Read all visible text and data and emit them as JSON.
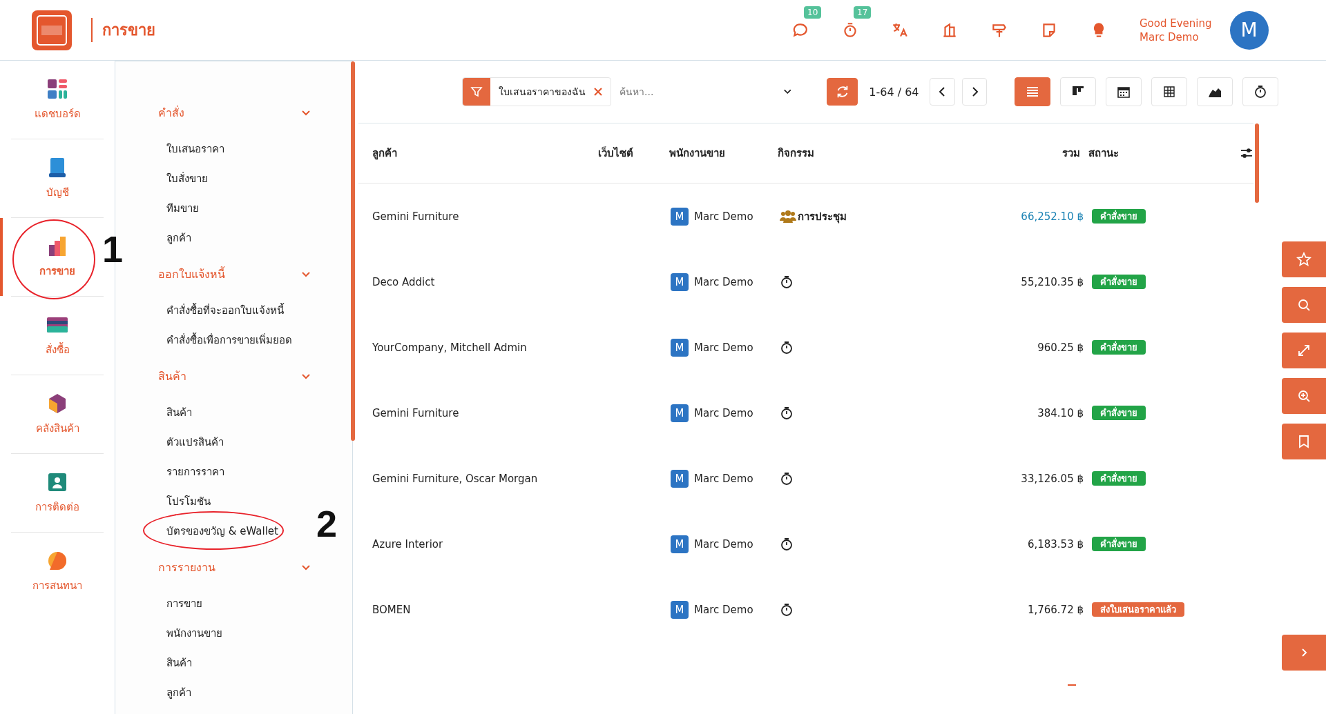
{
  "header": {
    "app_title": "การขาย",
    "badges": [
      {
        "kind": "chat",
        "count": "10"
      },
      {
        "kind": "timer",
        "count": "17"
      },
      {
        "kind": "translate"
      },
      {
        "kind": "building"
      },
      {
        "kind": "signpost"
      },
      {
        "kind": "note"
      },
      {
        "kind": "bulb"
      }
    ],
    "greeting": "Good Evening",
    "user_name": "Marc Demo",
    "avatar_letter": "M"
  },
  "rail": [
    {
      "kind": "dashboard",
      "label": "แดชบอร์ด",
      "selected": false
    },
    {
      "kind": "accounting",
      "label": "บัญชี",
      "selected": false
    },
    {
      "kind": "sales",
      "label": "การขาย",
      "selected": true
    },
    {
      "kind": "purchase",
      "label": "สั่งซื้อ",
      "selected": false
    },
    {
      "kind": "inventory",
      "label": "คลังสินค้า",
      "selected": false
    },
    {
      "kind": "contacts",
      "label": "การติดต่อ",
      "selected": false
    },
    {
      "kind": "discuss",
      "label": "การสนทนา",
      "selected": false
    }
  ],
  "menu": [
    {
      "label": "คำสั่ง",
      "expanded": true,
      "children": [
        {
          "label": "ใบเสนอราคา"
        },
        {
          "label": "ใบสั่งขาย"
        },
        {
          "label": "ทีมขาย"
        },
        {
          "label": "ลูกค้า"
        }
      ]
    },
    {
      "label": "ออกใบแจ้งหนี้",
      "expanded": true,
      "children": [
        {
          "label": "คำสั่งซื้อที่จะออกใบแจ้งหนี้"
        },
        {
          "label": "คำสั่งซื้อเพื่อการขายเพิ่มยอด"
        }
      ]
    },
    {
      "label": "สินค้า",
      "expanded": true,
      "children": [
        {
          "label": "สินค้า"
        },
        {
          "label": "ตัวแปรสินค้า"
        },
        {
          "label": "รายการราคา"
        },
        {
          "label": "โปรโมชัน"
        },
        {
          "label": "บัตรของขวัญ & eWallet"
        }
      ]
    },
    {
      "label": "การรายงาน",
      "expanded": true,
      "children": [
        {
          "label": "การขาย"
        },
        {
          "label": "พนักงานขาย"
        },
        {
          "label": "สินค้า"
        },
        {
          "label": "ลูกค้า"
        }
      ]
    }
  ],
  "annotations": [
    "1",
    "2"
  ],
  "toolbar": {
    "filter": "ใบเสนอราคาของฉัน",
    "search": {
      "placeholder": "ค้นหา..."
    },
    "pager": "1-64 / 64",
    "views": [
      {
        "kind": "list",
        "selected": true
      },
      {
        "kind": "kanban",
        "selected": false
      },
      {
        "kind": "calendar",
        "selected": false
      },
      {
        "kind": "pivot",
        "selected": false
      },
      {
        "kind": "graph",
        "selected": false
      },
      {
        "kind": "activity",
        "selected": false
      }
    ]
  },
  "table": {
    "columns": [
      "ลูกค้า",
      "เว็บไซต์",
      "พนักงานขาย",
      "กิจกรรม",
      "รวม",
      "สถานะ"
    ],
    "rows": [
      {
        "customer": "Gemini Furniture",
        "salesperson": "Marc Demo",
        "avatar_letter": "M",
        "activity": {
          "kind": "meeting",
          "label": "การประชุม"
        },
        "total": "66,252.10 ฿",
        "highlighted": true,
        "status": {
          "kind": "order",
          "label": "คำสั่งขาย"
        }
      },
      {
        "customer": "Deco Addict",
        "salesperson": "Marc Demo",
        "avatar_letter": "M",
        "activity": {
          "kind": "timer"
        },
        "total": "55,210.35 ฿",
        "highlighted": false,
        "status": {
          "kind": "order",
          "label": "คำสั่งขาย"
        }
      },
      {
        "customer": "YourCompany, Mitchell Admin",
        "salesperson": "Marc Demo",
        "avatar_letter": "M",
        "activity": {
          "kind": "timer"
        },
        "total": "960.25 ฿",
        "highlighted": false,
        "status": {
          "kind": "order",
          "label": "คำสั่งขาย"
        }
      },
      {
        "customer": "Gemini Furniture",
        "salesperson": "Marc Demo",
        "avatar_letter": "M",
        "activity": {
          "kind": "timer"
        },
        "total": "384.10 ฿",
        "highlighted": false,
        "status": {
          "kind": "order",
          "label": "คำสั่งขาย"
        }
      },
      {
        "customer": "Gemini Furniture, Oscar Morgan",
        "salesperson": "Marc Demo",
        "avatar_letter": "M",
        "activity": {
          "kind": "timer"
        },
        "total": "33,126.05 ฿",
        "highlighted": false,
        "status": {
          "kind": "order",
          "label": "คำสั่งขาย"
        }
      },
      {
        "customer": "Azure Interior",
        "salesperson": "Marc Demo",
        "avatar_letter": "M",
        "activity": {
          "kind": "timer"
        },
        "total": "6,183.53 ฿",
        "highlighted": false,
        "status": {
          "kind": "order",
          "label": "คำสั่งขาย"
        }
      },
      {
        "customer": "BOMEN",
        "salesperson": "Marc Demo",
        "avatar_letter": "M",
        "activity": {
          "kind": "timer"
        },
        "total": "1,766.72 ฿",
        "highlighted": false,
        "status": {
          "kind": "quote_sent",
          "label": "ส่งใบเสนอราคาแล้ว"
        }
      }
    ]
  },
  "side_tools": [
    {
      "kind": "star"
    },
    {
      "kind": "search"
    },
    {
      "kind": "expand"
    },
    {
      "kind": "zoom"
    },
    {
      "kind": "bookmark"
    }
  ]
}
